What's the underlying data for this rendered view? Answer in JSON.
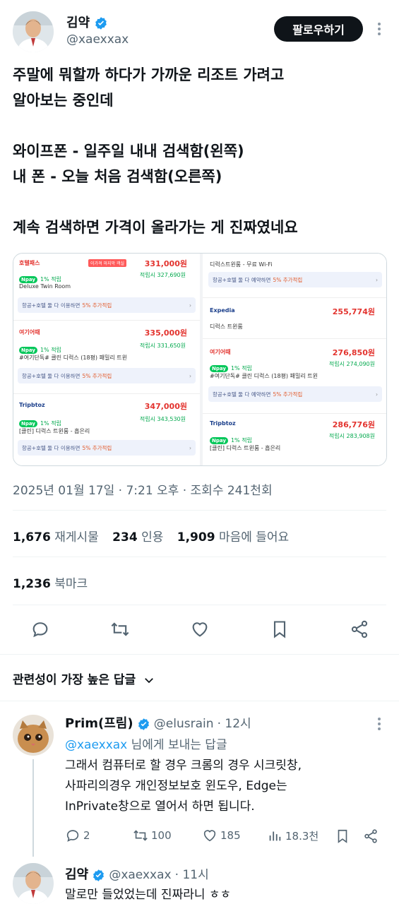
{
  "tweet": {
    "author_name": "김약",
    "author_handle": "@xaexxax",
    "follow_label": "팔로우하기",
    "text_lines": [
      "주말에 뭐할까 하다가 가까운 리조트 가려고",
      "알아보는 중인데",
      "",
      "와이프폰 - 일주일 내내 검색함(왼쪽)",
      "내 폰 - 오늘 처음 검색함(오른쪽)",
      "",
      "계속 검색하면 가격이 올라가는 게 진짜였네요"
    ],
    "meta": "2025년 01월 17일 · 7:21 오후 · 조회수 241천회",
    "stats": {
      "retweets": "1,676",
      "retweets_label": "재게시물",
      "quotes": "234",
      "quotes_label": "인용",
      "likes": "1,909",
      "likes_label": "마음에 들어요",
      "bookmarks": "1,236",
      "bookmarks_label": "북마크"
    },
    "accent_color": "#1d9bf0"
  },
  "media": {
    "left": {
      "cards": [
        {
          "brand": "호텔패스",
          "tag": "이가격 마지막 객실",
          "price": "331,000원",
          "rate": "1% 적립",
          "save": "적립시 327,690원",
          "room": "Deluxe Twin Room",
          "promo": "항공+호텔 둘 다 이용하면",
          "promo_pct": "5% 추가적립"
        },
        {
          "brand": "여기어때",
          "price": "335,000원",
          "rate": "1% 적립",
          "save": "적립시 331,650원",
          "room": "#여기단독# 클린 디럭스 (18평) 패밀리 트윈",
          "promo": "항공+호텔 둘 다 이용하면",
          "promo_pct": "5% 추가적립"
        },
        {
          "brand": "Tripbtoz",
          "price": "347,000원",
          "rate": "1% 적립",
          "save": "적립시 343,530원",
          "room": "[클린] 디럭스 트윈룸 - 흡은리",
          "promo": "항공+호텔 둘 다 이용하면",
          "promo_pct": "5% 추가적립"
        }
      ]
    },
    "right": {
      "top_room": "디럭스트윈룸 - 무료 Wi-Fi",
      "top_promo": "항공+호텔 둘 다 예약하면",
      "top_promo_pct": "5% 추가적립",
      "cards": [
        {
          "brand": "Expedia",
          "price": "255,774원",
          "room": "디럭스 트윈룸"
        },
        {
          "brand": "여기어때",
          "price": "276,850원",
          "rate": "1% 적립",
          "save": "적립시 274,090원",
          "room": "#여기단독# 클린 디럭스 (18평) 패밀리 트윈",
          "promo": "항공+호텔 둘 다 예약하면",
          "promo_pct": "5% 추가적립"
        },
        {
          "brand": "Tripbtoz",
          "price": "286,776원",
          "rate": "1% 적립",
          "save": "적립시 283,908원",
          "room": "[클린] 디럭스 트윈룸 - 흡은리"
        }
      ]
    }
  },
  "replies_header": "관련성이 가장 높은 답글",
  "replies": [
    {
      "name": "Prim(프림)",
      "handle": "@elusrain",
      "time": "· 12시",
      "reply_to_handle": "@xaexxax",
      "reply_to_suffix": " 님에게 보내는 답글",
      "body_lines": [
        "그래서 컴퓨터로 할 경우 크롬의 경우 시크릿창,",
        "사파리의경우 개인정보보호 윈도우, Edge는",
        "InPrivate창으로 열어서 하면 됩니다."
      ],
      "replies": "2",
      "retweets": "100",
      "likes": "185",
      "views": "18.3천"
    },
    {
      "name": "김약",
      "handle": "@xaexxax",
      "time": "· 11시",
      "body": "말로만 들었었는데 진짜라니 ㅎㅎ"
    }
  ]
}
